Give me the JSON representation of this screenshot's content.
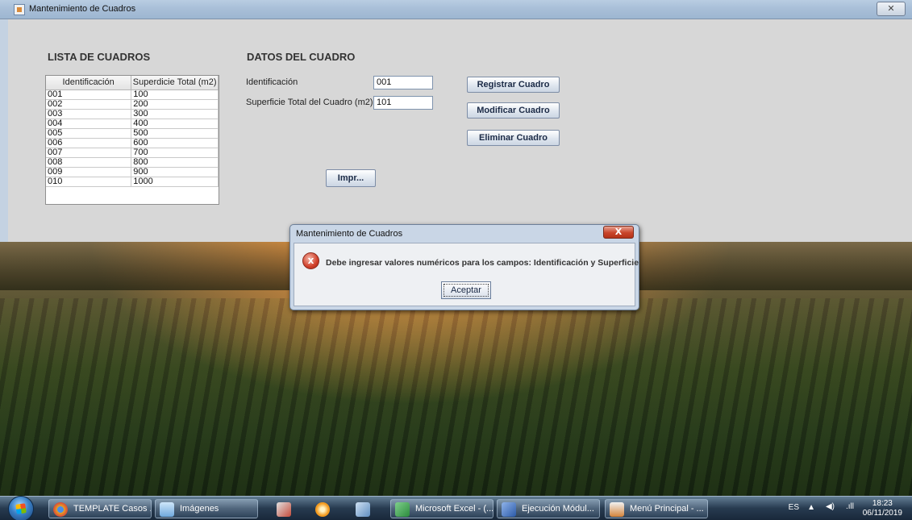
{
  "window": {
    "title": "Mantenimiento de Cuadros",
    "close_label": "✕"
  },
  "list_section": {
    "heading": "LISTA DE CUADROS",
    "columns": [
      "Identificación",
      "Superdicie Total (m2)"
    ],
    "rows": [
      [
        "001",
        "100"
      ],
      [
        "002",
        "200"
      ],
      [
        "003",
        "300"
      ],
      [
        "004",
        "400"
      ],
      [
        "005",
        "500"
      ],
      [
        "006",
        "600"
      ],
      [
        "007",
        "700"
      ],
      [
        "008",
        "800"
      ],
      [
        "009",
        "900"
      ],
      [
        "010",
        "1000"
      ]
    ]
  },
  "form": {
    "heading": "DATOS DEL CUADRO",
    "id_label": "Identificación",
    "id_value": "001",
    "area_label": "Superficie Total del Cuadro (m2)",
    "area_value": "101",
    "register_button": "Registrar Cuadro",
    "modify_button": "Modificar Cuadro",
    "delete_button": "Eliminar Cuadro",
    "print_button": "Impr..."
  },
  "dialog": {
    "title": "Mantenimiento de Cuadros",
    "close_label": "X",
    "icon": "error-icon",
    "icon_glyph": "x",
    "message": "Debe ingresar valores numéricos para los campos: Identificación y Superficie",
    "ok_button": "Aceptar"
  },
  "taskbar": {
    "items": [
      {
        "label": "TEMPLATE Casos ...",
        "icon": "chrome-icon",
        "color": "#e8a322"
      },
      {
        "label": "Imágenes",
        "icon": "folder-images-icon",
        "color": "#7bb4e3"
      },
      {
        "label": "",
        "icon": "snipping-tool-icon",
        "color": "#c64b3a"
      },
      {
        "label": "",
        "icon": "orange-app-icon",
        "color": "#f39a1e"
      },
      {
        "label": "",
        "icon": "network-app-icon",
        "color": "#5f8ec0"
      },
      {
        "label": "Microsoft Excel - (...",
        "icon": "excel-icon",
        "color": "#2c8b3d"
      },
      {
        "label": "Ejecución Módul...",
        "icon": "word-icon",
        "color": "#2b5aa8"
      },
      {
        "label": "Menú Principal - ...",
        "icon": "java-icon",
        "color": "#d4843a"
      }
    ],
    "tray": {
      "language": "ES",
      "time": "18:23",
      "date": "06/11/2019"
    }
  }
}
